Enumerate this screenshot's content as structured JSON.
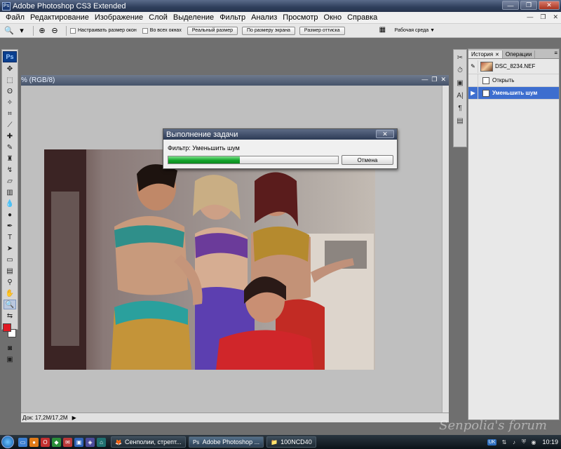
{
  "app": {
    "title": "Adobe Photoshop CS3 Extended",
    "logo": "Ps"
  },
  "menu": [
    "Файл",
    "Редактирование",
    "Изображение",
    "Слой",
    "Выделение",
    "Фильтр",
    "Анализ",
    "Просмотр",
    "Окно",
    "Справка"
  ],
  "options": {
    "resize_windows": "Настраивать размер окон",
    "all_windows": "Во всех окнах",
    "actual_pixels": "Реальный размер",
    "fit_screen": "По размеру экрана",
    "print_size": "Размер оттиска",
    "workspace": "Рабочая среда"
  },
  "document": {
    "title_suffix": "% (RGB/8)",
    "status": "Док: 17,2M/17,2M"
  },
  "dialog": {
    "title": "Выполнение задачи",
    "label": "Фильтр: Уменьшить шум",
    "progress": 0.42,
    "cancel": "Отмена",
    "close_glyph": "✕"
  },
  "history": {
    "tabs": [
      "История",
      "Операции"
    ],
    "snapshot": "DSC_8234.NEF",
    "items": [
      "Открыть",
      "Уменьшить шум"
    ]
  },
  "taskbar": {
    "buttons": [
      "Сенполии, стрепт...",
      "Adobe Photoshop ...",
      "100NCD40"
    ],
    "lang": "UK",
    "time": "10:19"
  },
  "watermark": "Senpolia's forum",
  "colors": {
    "foreground": "#e01a24",
    "progress": "#14a42c",
    "selection": "#3d6ecf"
  }
}
